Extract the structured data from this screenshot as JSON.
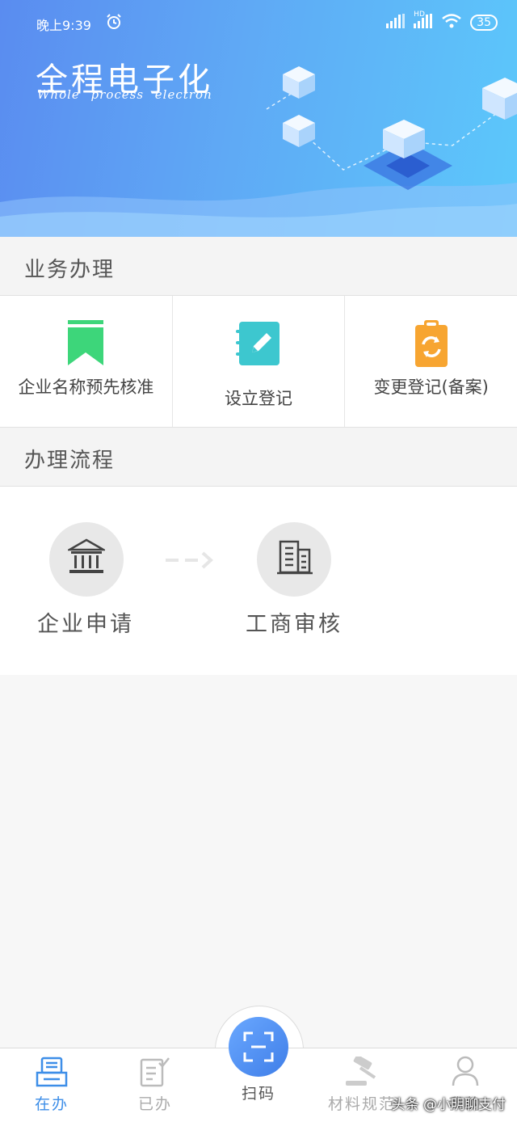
{
  "status_bar": {
    "time": "晚上9:39",
    "network": "HD",
    "battery": "35"
  },
  "banner": {
    "title": "全程电子化",
    "subtitle": "Whole process electron"
  },
  "business": {
    "heading": "业务办理",
    "items": [
      {
        "label": "企业名称预先核准",
        "icon": "bookmark-icon",
        "color": "#3dd67a"
      },
      {
        "label": "设立登记",
        "icon": "edit-note-icon",
        "color": "#3dc7cf"
      },
      {
        "label": "变更登记(备案)",
        "icon": "clipboard-refresh-icon",
        "color": "#f7a531"
      }
    ]
  },
  "process": {
    "heading": "办理流程",
    "steps": [
      {
        "label": "企业申请",
        "icon": "bank-icon"
      },
      {
        "label": "工商审核",
        "icon": "building-icon"
      }
    ]
  },
  "nav": {
    "items": [
      {
        "label": "在办",
        "icon": "printer-tray-icon",
        "active": true
      },
      {
        "label": "已办",
        "icon": "checklist-icon",
        "active": false
      },
      {
        "label": "扫码",
        "icon": "scan-icon",
        "active": false
      },
      {
        "label": "材料规范",
        "icon": "gavel-icon",
        "active": false
      },
      {
        "label": "我的",
        "icon": "user-icon",
        "active": false
      }
    ]
  },
  "watermark": "头条 @小明聊支付",
  "colors": {
    "accent": "#3d8ee8",
    "banner_start": "#5a8cf0",
    "banner_end": "#5cc8fb"
  }
}
